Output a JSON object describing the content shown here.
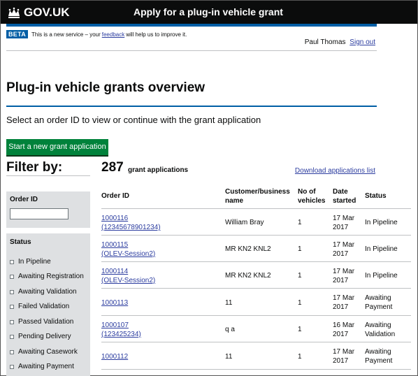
{
  "header": {
    "logo_text": "GOV.UK",
    "service_name": "Apply for a plug-in vehicle grant",
    "brand_color": "#005ea5"
  },
  "beta": {
    "tag": "BETA",
    "text_before": "This is a new service – your",
    "link": "feedback",
    "text_after": "will help us to improve it."
  },
  "user": {
    "name": "Paul Thomas",
    "sign_out": "Sign out"
  },
  "page": {
    "title": "Plug-in vehicle grants overview",
    "lead": "Select an order ID to view or continue with the grant application",
    "start_button": "Start a new grant application"
  },
  "filter": {
    "title": "Filter by:",
    "order_id_label": "Order ID",
    "status_label": "Status",
    "statuses": [
      "In Pipeline",
      "Awaiting Registration",
      "Awaiting Validation",
      "Failed Validation",
      "Passed Validation",
      "Pending Delivery",
      "Awaiting Casework",
      "Awaiting Payment"
    ]
  },
  "results": {
    "count": "287",
    "count_label": "grant applications",
    "download": "Download applications list"
  },
  "table": {
    "headers": {
      "order_id": "Order ID",
      "customer_1": "Customer/business",
      "customer_2": "name",
      "vehicles_1": "No of",
      "vehicles_2": "vehicles",
      "date_1": "Date",
      "date_2": "started",
      "status": "Status"
    },
    "rows": [
      {
        "id_1": "1000116",
        "id_2": "(12345678901234)",
        "customer": "William Bray",
        "vehicles": "1",
        "date_1": "17 Mar",
        "date_2": "2017",
        "status_1": "In Pipeline",
        "status_2": ""
      },
      {
        "id_1": "1000115",
        "id_2": "(OLEV-Session2)",
        "customer": "MR KN2 KNL2",
        "vehicles": "1",
        "date_1": "17 Mar",
        "date_2": "2017",
        "status_1": "In Pipeline",
        "status_2": ""
      },
      {
        "id_1": "1000114",
        "id_2": "(OLEV-Session2)",
        "customer": "MR KN2 KNL2",
        "vehicles": "1",
        "date_1": "17 Mar",
        "date_2": "2017",
        "status_1": "In Pipeline",
        "status_2": ""
      },
      {
        "id_1": "1000113",
        "id_2": "",
        "customer": "11",
        "vehicles": "1",
        "date_1": "17 Mar",
        "date_2": "2017",
        "status_1": "Awaiting",
        "status_2": "Payment"
      },
      {
        "id_1": "1000107",
        "id_2": "(123425234)",
        "customer": "q a",
        "vehicles": "1",
        "date_1": "16 Mar",
        "date_2": "2017",
        "status_1": "Awaiting",
        "status_2": "Validation"
      },
      {
        "id_1": "1000112",
        "id_2": "",
        "customer": "11",
        "vehicles": "1",
        "date_1": "17 Mar",
        "date_2": "2017",
        "status_1": "Awaiting",
        "status_2": "Payment"
      }
    ]
  }
}
